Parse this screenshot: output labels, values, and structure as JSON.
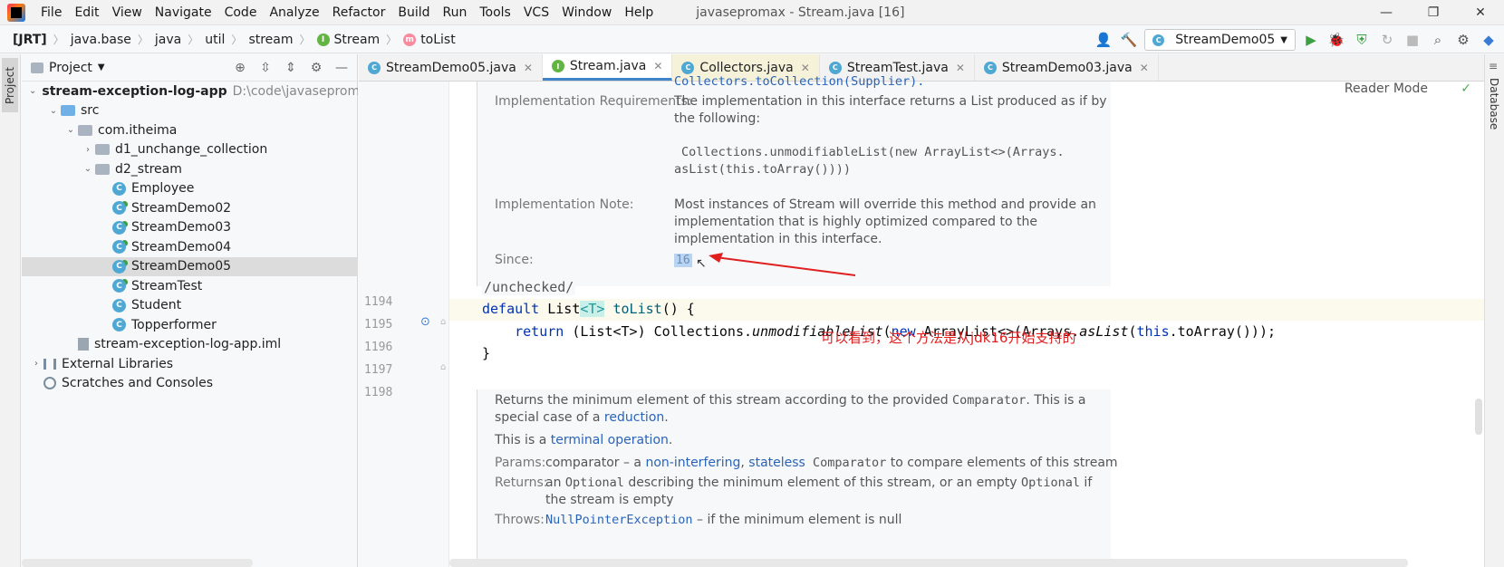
{
  "menubar": {
    "items": [
      "File",
      "Edit",
      "View",
      "Navigate",
      "Code",
      "Analyze",
      "Refactor",
      "Build",
      "Run",
      "Tools",
      "VCS",
      "Window",
      "Help"
    ],
    "window_title": "javasepromax - Stream.java [16]"
  },
  "navbar": {
    "crumbs": [
      "[JRT]",
      "java.base",
      "java",
      "util",
      "stream",
      "Stream",
      "toList"
    ],
    "run_config": "StreamDemo05"
  },
  "project_panel": {
    "title": "Project",
    "tree": [
      {
        "label": "stream-exception-log-app",
        "hint": "D:\\code\\javasepromax\\",
        "kind": "module",
        "depth": 0
      },
      {
        "label": "src",
        "kind": "folder-blue",
        "depth": 1
      },
      {
        "label": "com.itheima",
        "kind": "package",
        "depth": 2
      },
      {
        "label": "d1_unchange_collection",
        "kind": "package",
        "depth": 3
      },
      {
        "label": "d2_stream",
        "kind": "package",
        "depth": 3
      },
      {
        "label": "Employee",
        "kind": "class",
        "depth": 4
      },
      {
        "label": "StreamDemo02",
        "kind": "class-run",
        "depth": 4
      },
      {
        "label": "StreamDemo03",
        "kind": "class-run",
        "depth": 4
      },
      {
        "label": "StreamDemo04",
        "kind": "class-run",
        "depth": 4
      },
      {
        "label": "StreamDemo05",
        "kind": "class-run",
        "depth": 4,
        "selected": true
      },
      {
        "label": "StreamTest",
        "kind": "class-run",
        "depth": 4
      },
      {
        "label": "Student",
        "kind": "class",
        "depth": 4
      },
      {
        "label": "Topperformer",
        "kind": "class",
        "depth": 4
      },
      {
        "label": "stream-exception-log-app.iml",
        "kind": "file",
        "depth": 2
      },
      {
        "label": "External Libraries",
        "kind": "lib",
        "depth": 0
      },
      {
        "label": "Scratches and Consoles",
        "kind": "scratch",
        "depth": 0
      }
    ]
  },
  "tabs": [
    {
      "label": "StreamDemo05.java",
      "state": "normal"
    },
    {
      "label": "Stream.java",
      "state": "active"
    },
    {
      "label": "Collectors.java",
      "state": "yellow"
    },
    {
      "label": "StreamTest.java",
      "state": "normal"
    },
    {
      "label": "StreamDemo03.java",
      "state": "normal"
    }
  ],
  "left_strip": {
    "project_tab": "Project"
  },
  "right_strip": {
    "database_tab": "Database"
  },
  "editor": {
    "reader_mode": "Reader Mode",
    "doc_top": {
      "collectors_link": "Collectors.toCollection(Supplier).",
      "impl_req_label": "Implementation Requirements:",
      "impl_req_text1": "The implementation in this interface returns a List produced as if by",
      "impl_req_text2": "the following:",
      "impl_req_code1": "Collections.unmodifiableList(new ArrayList<>(Arrays.",
      "impl_req_code2": "asList(this.toArray())))",
      "impl_note_label": "Implementation Note:",
      "impl_note_text1": "Most instances of Stream will override this method and provide an",
      "impl_note_text2": "implementation that is highly optimized compared to the",
      "impl_note_text3": "implementation in this interface.",
      "since_label": "Since:",
      "since_value": "16"
    },
    "line_numbers": [
      "1194",
      "1195",
      "1196",
      "1197",
      "1198"
    ],
    "code": {
      "annotation": "/unchecked/",
      "l1_kw": "default",
      "l1_type": " List",
      "l1_tparam": "<T>",
      "l1_meth": "toList",
      "l1_rest": "() {",
      "l2_kw": "    return",
      "l2_a": " (List<T>) Collections.",
      "l2_it": "unmodifiableList",
      "l2_b": "(",
      "l2_new": "new",
      "l2_c": " ArrayList<>(Arrays.",
      "l2_it2": "asList",
      "l2_d": "(",
      "l2_this": "this",
      "l2_e": ".toArray()));",
      "l3": "}"
    },
    "doc_bottom": {
      "p1_a": "Returns the minimum element of this stream according to the provided ",
      "p1_code": "Comparator",
      "p1_b": ". This is a",
      "p1_c": "special case of a ",
      "p1_link": "reduction",
      "p1_d": ".",
      "p2_a": "This is a ",
      "p2_link": "terminal operation",
      "p2_b": ".",
      "params_label": "Params:",
      "params_a": "comparator – a ",
      "params_link1": "non-interfering",
      "params_sep": ", ",
      "params_link2": "stateless",
      "params_code": " Comparator",
      "params_b": " to compare elements of this stream",
      "returns_label": "Returns:",
      "returns_a": "an ",
      "returns_code1": "Optional",
      "returns_b": " describing the minimum element of this stream, or an empty ",
      "returns_code2": "Optional",
      "returns_c": " if",
      "returns_d": "the stream is empty",
      "throws_label": "Throws:",
      "throws_link": "NullPointerException",
      "throws_b": " – if the minimum element is null"
    },
    "annotation_note": "可以看到，这个方法是从jdk16开始支持的"
  },
  "colors": {
    "accent": "#4083c9",
    "annotation_red": "#e02020",
    "keyword": "#0033b3"
  }
}
